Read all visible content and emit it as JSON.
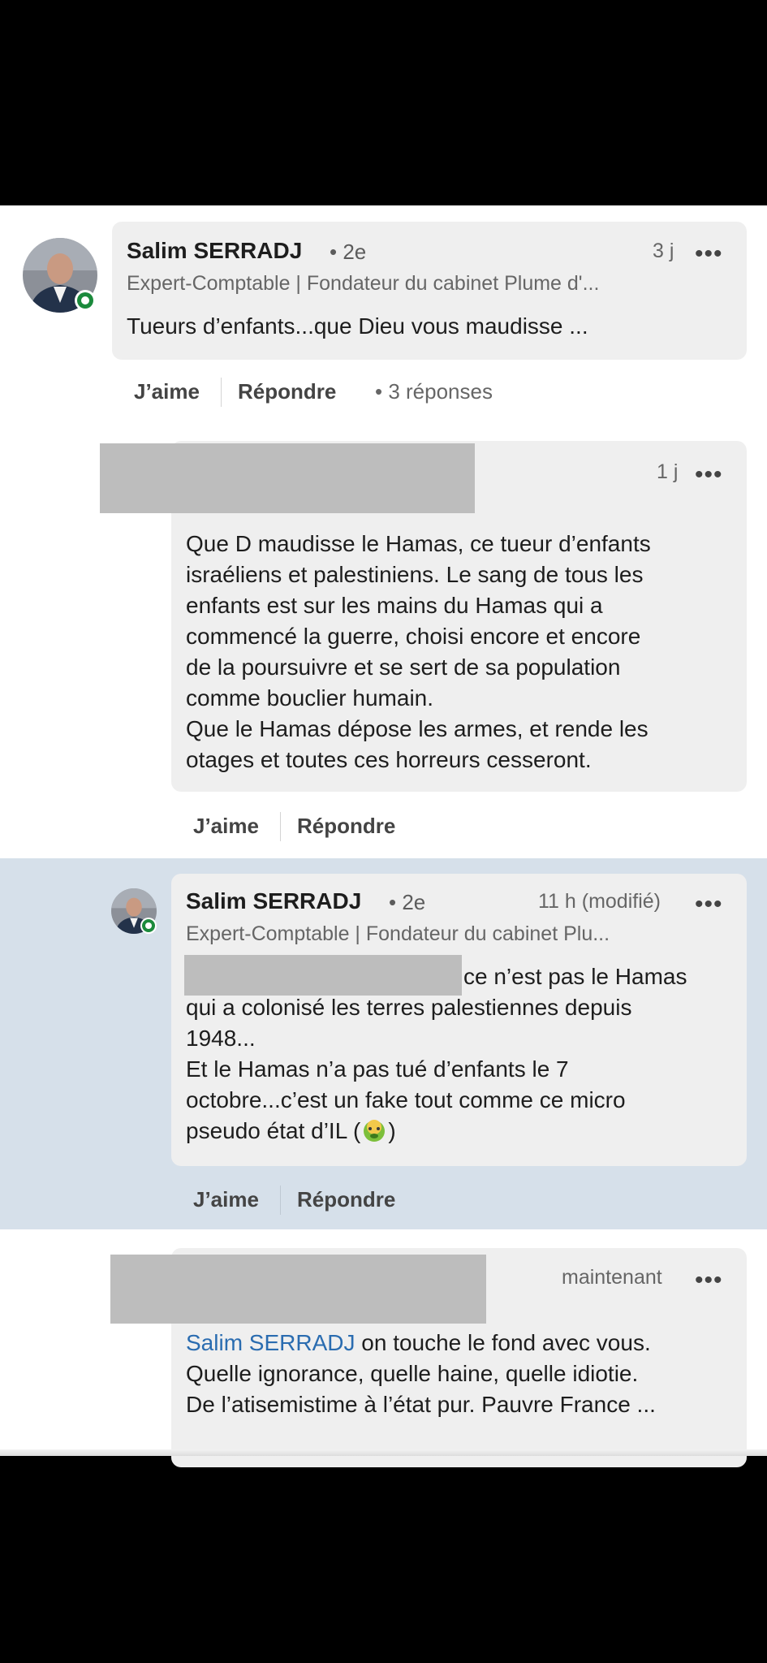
{
  "comment1": {
    "author": "Salim SERRADJ",
    "degree": "• 2e",
    "headline": "Expert-Comptable | Fondateur du cabinet Plume d'...",
    "time": "3 j",
    "more": "•••",
    "text": "Tueurs d’enfants...que Dieu vous maudisse ...",
    "actions": {
      "like": "J’aime",
      "reply": "Répondre",
      "replies": "• 3 réponses"
    }
  },
  "reply1": {
    "time": "1 j",
    "more": "•••",
    "lines": [
      "Que D maudisse le Hamas, ce tueur d’enfants",
      "israéliens et palestiniens. Le sang de tous les",
      "enfants est sur les mains du Hamas qui a",
      "commencé la guerre, choisi encore et encore",
      "de la poursuivre et se sert de sa population",
      "comme bouclier humain.",
      "Que le Hamas dépose les armes, et rende les",
      "otages et toutes ces horreurs cesseront."
    ],
    "actions": {
      "like": "J’aime",
      "reply": "Répondre"
    }
  },
  "reply2": {
    "author": "Salim SERRADJ",
    "degree": "• 2e",
    "headline": "Expert-Comptable | Fondateur du cabinet Plu...",
    "time": "11 h (modifié)",
    "more": "•••",
    "first_line_rest": "ce n’est pas le Hamas",
    "lines": [
      "qui a colonisé les terres palestiennes depuis",
      "1948...",
      "Et le Hamas n’a pas tué d’enfants le 7",
      "octobre...c’est un fake tout comme ce micro"
    ],
    "last_line_prefix": "pseudo état d’IL (",
    "last_line_suffix": ")",
    "emoji_icon": "nauseated-face-icon",
    "actions": {
      "like": "J’aime",
      "reply": "Répondre"
    }
  },
  "reply3": {
    "time": "maintenant",
    "more": "•••",
    "mention": "Salim SERRADJ",
    "first_line_rest": " on touche le fond avec vous.",
    "lines": [
      "Quelle ignorance, quelle haine, quelle idiotie.",
      "De l’atisemistime à l’état pur. Pauvre France ..."
    ]
  },
  "colors": {
    "highlight": "#d6e0ea",
    "mention": "#2a6cb0",
    "online": "#1b8a3c"
  }
}
